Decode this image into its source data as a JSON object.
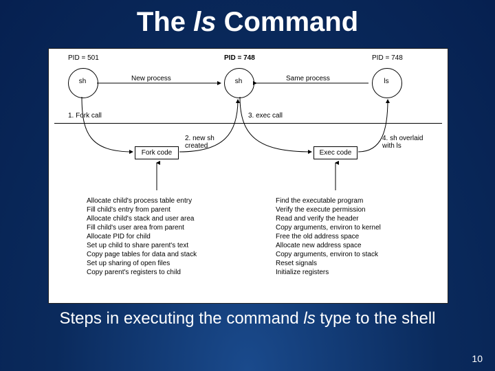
{
  "title_pre": "The ",
  "title_it": "ls",
  "title_post": " Command",
  "pid1": "PID = 501",
  "pid2": "PID = 748",
  "pid3": "PID = 748",
  "node1": "sh",
  "node2": "sh",
  "node3": "ls",
  "arrow_np": "New process",
  "arrow_sp": "Same process",
  "step1": "1. Fork call",
  "step2": "2. new sh\ncreated",
  "step3": "3. exec call",
  "step4": "4. sh overlaid\nwith ls",
  "box_fork": "Fork code",
  "box_exec": "Exec code",
  "fork_list": "Allocate child's process table entry\nFill child's entry from parent\nAllocate child's stack and user area\nFill child's user area from parent\nAllocate PID for child\nSet up child to share parent's text\nCopy page tables for data and stack\nSet up sharing of open files\nCopy parent's registers to child",
  "exec_list": "Find the executable program\nVerify the execute permission\nRead and verify the header\nCopy arguments, environ to kernel\nFree the old address space\nAllocate new address space\nCopy arguments, environ to stack\nReset signals\nInitialize registers",
  "caption_pre": "Steps in executing the command ",
  "caption_it": "ls",
  "caption_post": " type to the shell",
  "pagenum": "10"
}
